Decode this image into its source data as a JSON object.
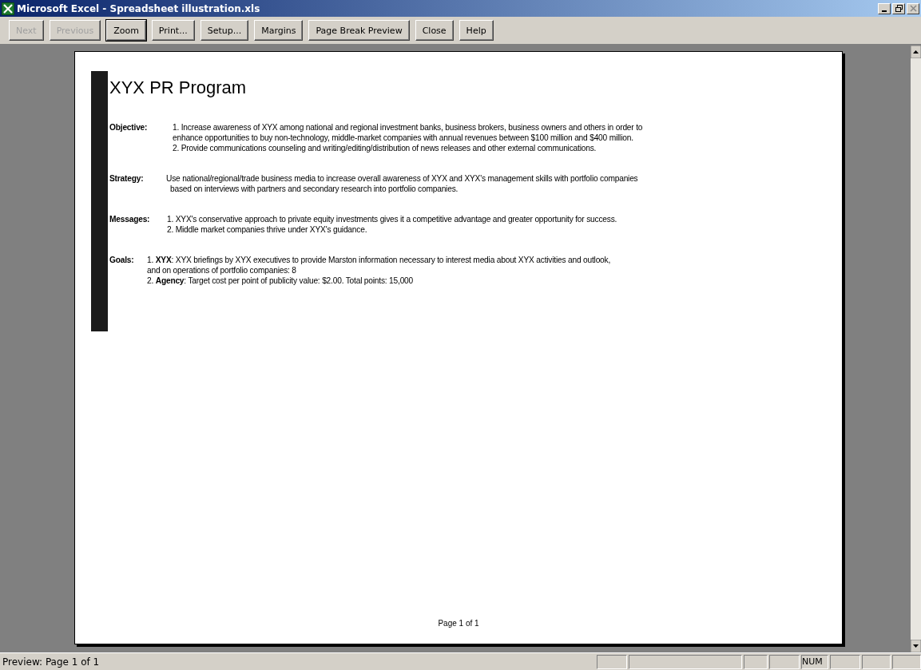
{
  "window": {
    "title": "Microsoft Excel - Spreadsheet illustration.xls"
  },
  "toolbar": [
    {
      "label": "Next",
      "disabled": true,
      "default": false
    },
    {
      "label": "Previous",
      "disabled": true,
      "default": false
    },
    {
      "label": "Zoom",
      "disabled": false,
      "default": true
    },
    {
      "label": "Print...",
      "disabled": false,
      "default": false
    },
    {
      "label": "Setup...",
      "disabled": false,
      "default": false
    },
    {
      "label": "Margins",
      "disabled": false,
      "default": false
    },
    {
      "label": "Page Break Preview",
      "disabled": false,
      "default": false
    },
    {
      "label": "Close",
      "disabled": false,
      "default": false
    },
    {
      "label": "Help",
      "disabled": false,
      "default": false
    }
  ],
  "page": {
    "title": "XYX PR Program",
    "sections": [
      {
        "label": "Objective:",
        "lines": [
          "1. Increase awareness of XYX among national and regional investment banks, business brokers, business owners and others in order to",
          "enhance opportunities  to buy non-technology, middle-market companies with annual revenues between $100 million and $400 million.",
          "2. Provide communications counseling and writing/editing/distribution of news releases and other external communications."
        ]
      },
      {
        "label": "Strategy:",
        "lines": [
          "Use national/regional/trade business media to increase overall awareness of XYX and XYX's management skills with portfolio companies",
          "based on interviews with partners and secondary research into portfolio companies."
        ]
      },
      {
        "label": "Messages:",
        "lines": [
          "1.  XYX's conservative approach to private equity investments gives it a competitive advantage and greater opportunity for success.",
          "2.  Middle market companies thrive under XYX's guidance."
        ]
      },
      {
        "label": "Goals:",
        "lines": [
          "1.  **XYX**:  XYX briefings by XYX executives to provide Marston information necessary to interest media about XYX activities and outlook,",
          "and on operations of portfolio companies: 8",
          "2.  **Agency**:  Target cost per point of publicity value:  $2.00.  Total points:  15,000"
        ]
      }
    ],
    "footer": "Page 1 of 1"
  },
  "status_bar": {
    "text": "Preview: Page 1 of 1",
    "num_indicator": "NUM"
  }
}
